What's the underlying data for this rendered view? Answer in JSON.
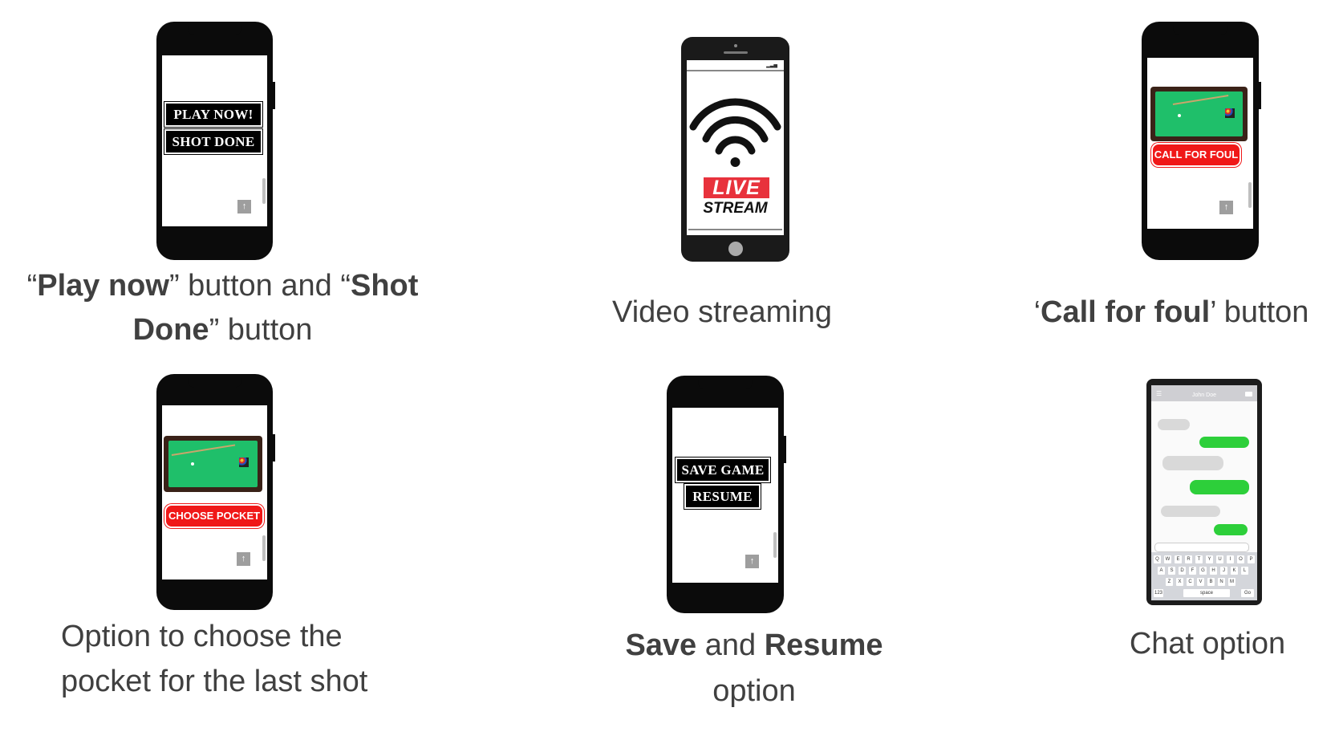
{
  "panels": {
    "p1": {
      "play_label": "PLAY NOW!",
      "shot_label": "SHOT DONE",
      "up_glyph": "↑",
      "caption": {
        "q1": "“",
        "b1": "Play now",
        "t1": "” button and “",
        "b2": "Shot",
        "b3": "Done",
        "t2": "” button"
      }
    },
    "p2": {
      "live_label": "LIVE",
      "stream_label": "STREAM",
      "caption": "Video streaming"
    },
    "p3": {
      "foul_label": "CALL FOR FOUL",
      "up_glyph": "↑",
      "caption": {
        "q1": "‘",
        "b1": "Call for foul",
        "t1": "’ button"
      }
    },
    "p4": {
      "pocket_label": "CHOOSE POCKET",
      "up_glyph": "↑",
      "caption_line1": "Option to choose the",
      "caption_line2": "pocket for the last shot"
    },
    "p5": {
      "save_label": "SAVE GAME",
      "resume_label": "RESUME",
      "up_glyph": "↑",
      "caption": {
        "b1": "Save",
        "t1": " and ",
        "b2": "Resume",
        "t2": "option"
      }
    },
    "p6": {
      "contact_name": "John Doe",
      "keyboard_rows": [
        [
          "Q",
          "W",
          "E",
          "R",
          "T",
          "Y",
          "U",
          "I",
          "O",
          "P"
        ],
        [
          "A",
          "S",
          "D",
          "F",
          "G",
          "H",
          "J",
          "K",
          "L"
        ],
        [
          "Z",
          "X",
          "C",
          "V",
          "B",
          "N",
          "M"
        ]
      ],
      "space_label": "space",
      "go_label": "Go",
      "num_label": "123",
      "caption": "Chat option"
    }
  },
  "colors": {
    "caption_text": "#404040",
    "red_button": "#f01818",
    "felt": "#1fbf6a",
    "live_red": "#e8323c",
    "chat_green": "#2dcf3a"
  }
}
